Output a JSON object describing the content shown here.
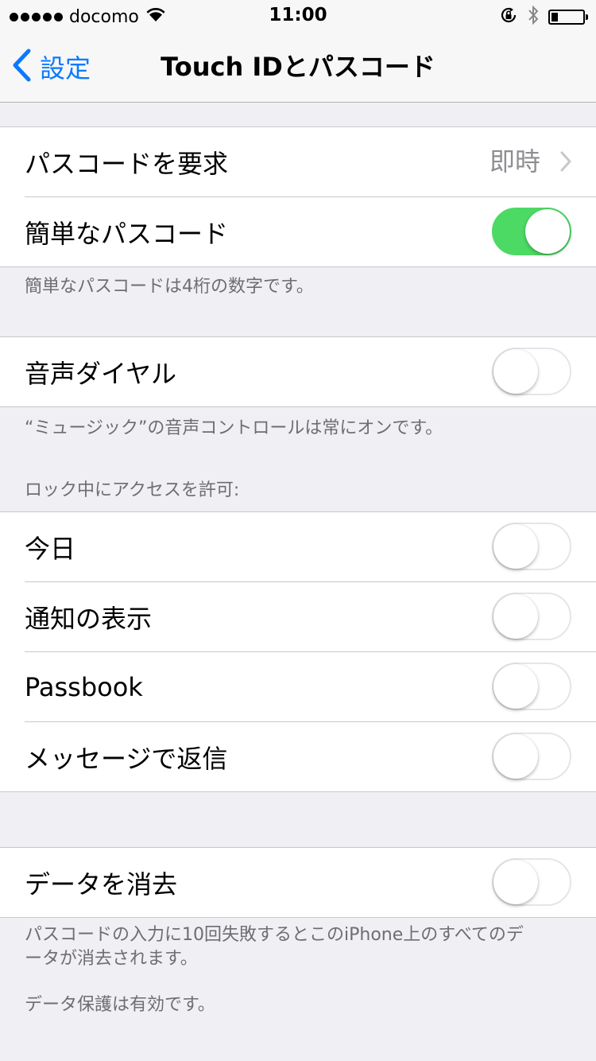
{
  "status_bar": {
    "carrier": "docomo",
    "time": "11:00",
    "icons": [
      "signal-dots-icon",
      "wifi-icon",
      "rotation-lock-icon",
      "bluetooth-icon",
      "battery-icon"
    ]
  },
  "nav": {
    "back_label": "設定",
    "title": "Touch IDとパスコード"
  },
  "groups": {
    "passcode": {
      "require_label": "パスコードを要求",
      "require_value": "即時",
      "simple_label": "簡単なパスコード",
      "simple_on": true,
      "footer": "簡単なパスコードは4桁の数字です。"
    },
    "voice": {
      "label": "音声ダイヤル",
      "on": false,
      "footer": "“ミュージック”の音声コントロールは常にオンです。"
    },
    "lock_access": {
      "header": "ロック中にアクセスを許可:",
      "items": [
        {
          "label": "今日",
          "on": false
        },
        {
          "label": "通知の表示",
          "on": false
        },
        {
          "label": "Passbook",
          "on": false
        },
        {
          "label": "メッセージで返信",
          "on": false
        }
      ]
    },
    "erase": {
      "label": "データを消去",
      "on": false,
      "footer": "パスコードの入力に10回失敗するとこのiPhone上のすべてのデ\nータが消去されます。",
      "footer2": "データ保護は有効です。"
    }
  },
  "colors": {
    "accent": "#0a7aff",
    "toggle_on": "#4cd964",
    "background": "#efeff4",
    "secondary_text": "#8e8e93",
    "footer_text": "#6d6d72"
  }
}
